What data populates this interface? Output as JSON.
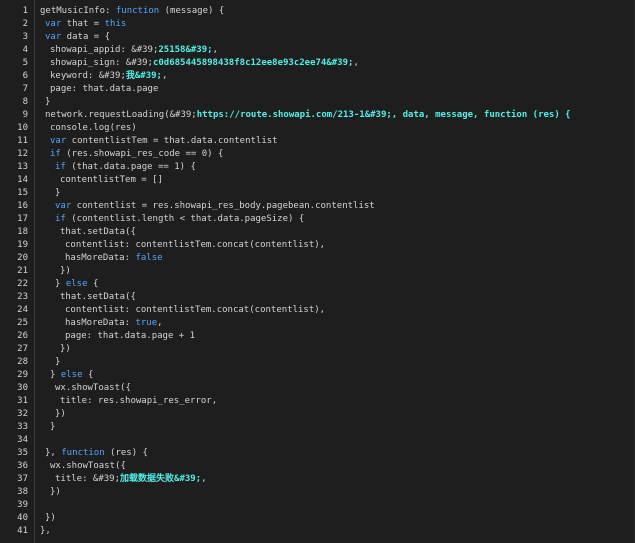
{
  "editor": {
    "lines": [
      {
        "n": "1",
        "indent": 0,
        "tokens": [
          {
            "t": "getMusicInfo: "
          },
          {
            "t": "function",
            "c": "kw"
          },
          {
            "t": " (message) {"
          }
        ]
      },
      {
        "n": "2",
        "indent": 1,
        "tokens": [
          {
            "t": "var",
            "c": "kw"
          },
          {
            "t": " that = "
          },
          {
            "t": "this",
            "c": "kw"
          }
        ]
      },
      {
        "n": "3",
        "indent": 1,
        "tokens": [
          {
            "t": "var",
            "c": "kw"
          },
          {
            "t": " data = {"
          }
        ]
      },
      {
        "n": "4",
        "indent": 2,
        "tokens": [
          {
            "t": "showapi_appid: &#39;"
          },
          {
            "t": "25158&#39;",
            "c": "str"
          },
          {
            "t": ","
          }
        ]
      },
      {
        "n": "5",
        "indent": 2,
        "tokens": [
          {
            "t": "showapi_sign: &#39;"
          },
          {
            "t": "c0d685445898438f8c12ee8e93c2ee74&#39;",
            "c": "str"
          },
          {
            "t": ","
          }
        ]
      },
      {
        "n": "6",
        "indent": 2,
        "tokens": [
          {
            "t": "keyword: &#39;"
          },
          {
            "t": "我&#39;",
            "c": "str"
          },
          {
            "t": ","
          }
        ]
      },
      {
        "n": "7",
        "indent": 2,
        "tokens": [
          {
            "t": "page: that.data.page"
          }
        ]
      },
      {
        "n": "8",
        "indent": 1,
        "tokens": [
          {
            "t": "}"
          }
        ]
      },
      {
        "n": "9",
        "indent": 1,
        "tokens": [
          {
            "t": "network.requestLoading(&#39;"
          },
          {
            "t": "https://route.showapi.com/213-1&#39;, data, message, function (res) {",
            "c": "str"
          }
        ]
      },
      {
        "n": "10",
        "indent": 2,
        "tokens": [
          {
            "t": "console.log(res)"
          }
        ]
      },
      {
        "n": "11",
        "indent": 2,
        "tokens": [
          {
            "t": "var",
            "c": "kw"
          },
          {
            "t": " contentlistTem = that.data.contentlist"
          }
        ]
      },
      {
        "n": "12",
        "indent": 2,
        "tokens": [
          {
            "t": "if",
            "c": "kw"
          },
          {
            "t": " (res.showapi_res_code == 0) {"
          }
        ]
      },
      {
        "n": "13",
        "indent": 3,
        "tokens": [
          {
            "t": "if",
            "c": "kw"
          },
          {
            "t": " (that.data.page == 1) {"
          }
        ]
      },
      {
        "n": "14",
        "indent": 4,
        "tokens": [
          {
            "t": "contentlistTem = []"
          }
        ]
      },
      {
        "n": "15",
        "indent": 3,
        "tokens": [
          {
            "t": "}"
          }
        ]
      },
      {
        "n": "16",
        "indent": 3,
        "tokens": [
          {
            "t": "var",
            "c": "kw"
          },
          {
            "t": " contentlist = res.showapi_res_body.pagebean.contentlist"
          }
        ]
      },
      {
        "n": "17",
        "indent": 3,
        "tokens": [
          {
            "t": "if",
            "c": "kw"
          },
          {
            "t": " (contentlist.length < that.data.pageSize) {"
          }
        ]
      },
      {
        "n": "18",
        "indent": 4,
        "tokens": [
          {
            "t": "that.setData({"
          }
        ]
      },
      {
        "n": "19",
        "indent": 5,
        "tokens": [
          {
            "t": "contentlist: contentlistTem.concat(contentlist),"
          }
        ]
      },
      {
        "n": "20",
        "indent": 5,
        "tokens": [
          {
            "t": "hasMoreData: "
          },
          {
            "t": "false",
            "c": "kw"
          }
        ]
      },
      {
        "n": "21",
        "indent": 4,
        "tokens": [
          {
            "t": "})"
          }
        ]
      },
      {
        "n": "22",
        "indent": 3,
        "tokens": [
          {
            "t": "} "
          },
          {
            "t": "else",
            "c": "kw"
          },
          {
            "t": " {"
          }
        ]
      },
      {
        "n": "23",
        "indent": 4,
        "tokens": [
          {
            "t": "that.setData({"
          }
        ]
      },
      {
        "n": "24",
        "indent": 5,
        "tokens": [
          {
            "t": "contentlist: contentlistTem.concat(contentlist),"
          }
        ]
      },
      {
        "n": "25",
        "indent": 5,
        "tokens": [
          {
            "t": "hasMoreData: "
          },
          {
            "t": "true",
            "c": "kw"
          },
          {
            "t": ","
          }
        ]
      },
      {
        "n": "26",
        "indent": 5,
        "tokens": [
          {
            "t": "page: that.data.page + 1"
          }
        ]
      },
      {
        "n": "27",
        "indent": 4,
        "tokens": [
          {
            "t": "})"
          }
        ]
      },
      {
        "n": "28",
        "indent": 3,
        "tokens": [
          {
            "t": "}"
          }
        ]
      },
      {
        "n": "29",
        "indent": 2,
        "tokens": [
          {
            "t": "} "
          },
          {
            "t": "else",
            "c": "kw"
          },
          {
            "t": " {"
          }
        ]
      },
      {
        "n": "30",
        "indent": 3,
        "tokens": [
          {
            "t": "wx.showToast({"
          }
        ]
      },
      {
        "n": "31",
        "indent": 4,
        "tokens": [
          {
            "t": "title: res.showapi_res_error,"
          }
        ]
      },
      {
        "n": "32",
        "indent": 3,
        "tokens": [
          {
            "t": "})"
          }
        ]
      },
      {
        "n": "33",
        "indent": 2,
        "tokens": [
          {
            "t": "}"
          }
        ]
      },
      {
        "n": "34",
        "indent": 0,
        "tokens": [
          {
            "t": ""
          }
        ]
      },
      {
        "n": "35",
        "indent": 1,
        "tokens": [
          {
            "t": "}, "
          },
          {
            "t": "function",
            "c": "kw"
          },
          {
            "t": " (res) {"
          }
        ]
      },
      {
        "n": "36",
        "indent": 2,
        "tokens": [
          {
            "t": "wx.showToast({"
          }
        ]
      },
      {
        "n": "37",
        "indent": 3,
        "tokens": [
          {
            "t": "title: &#39;"
          },
          {
            "t": "加载数据失败&#39;",
            "c": "str"
          },
          {
            "t": ","
          }
        ]
      },
      {
        "n": "38",
        "indent": 2,
        "tokens": [
          {
            "t": "})"
          }
        ]
      },
      {
        "n": "39",
        "indent": 0,
        "tokens": [
          {
            "t": ""
          }
        ]
      },
      {
        "n": "40",
        "indent": 1,
        "tokens": [
          {
            "t": "})"
          }
        ]
      },
      {
        "n": "41",
        "indent": 0,
        "tokens": [
          {
            "t": "},"
          }
        ]
      }
    ]
  }
}
